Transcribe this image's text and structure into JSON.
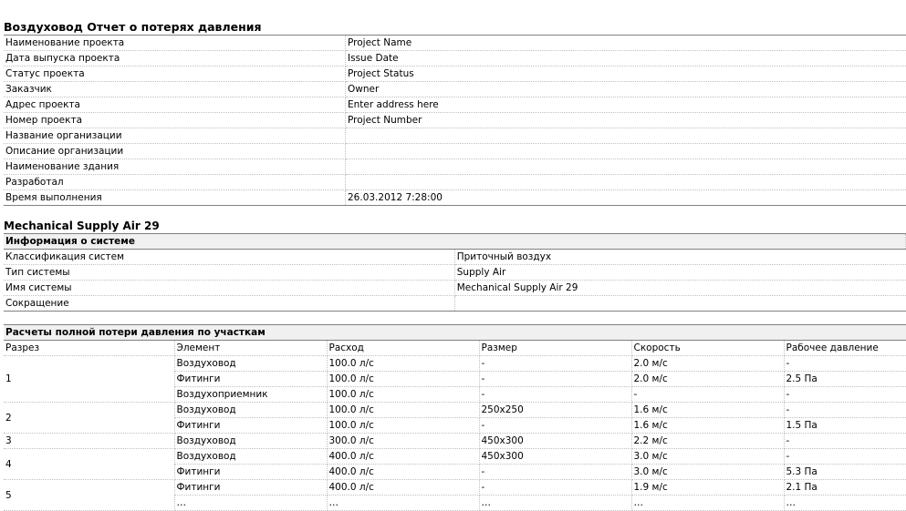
{
  "report_title": "Воздуховод Отчет о потерях давления",
  "project_info": [
    {
      "label": "Наименование проекта",
      "value": "Project Name"
    },
    {
      "label": "Дата выпуска проекта",
      "value": "Issue Date"
    },
    {
      "label": "Статус проекта",
      "value": "Project Status"
    },
    {
      "label": "Заказчик",
      "value": "Owner"
    },
    {
      "label": "Адрес проекта",
      "value": "Enter address here"
    },
    {
      "label": "Номер проекта",
      "value": "Project Number"
    },
    {
      "label": "Название организации",
      "value": ""
    },
    {
      "label": "Описание организации",
      "value": ""
    },
    {
      "label": "Наименование здания",
      "value": ""
    },
    {
      "label": "Разработал",
      "value": ""
    },
    {
      "label": "Время выполнения",
      "value": "26.03.2012 7:28:00"
    }
  ],
  "system_title": "Mechanical Supply Air 29",
  "system_info_header": "Информация о системе",
  "system_info": [
    {
      "label": "Классификация систем",
      "value": "Приточный воздух"
    },
    {
      "label": "Тип системы",
      "value": "Supply Air"
    },
    {
      "label": "Имя системы",
      "value": "Mechanical Supply Air 29"
    },
    {
      "label": "Сокращение",
      "value": ""
    }
  ],
  "calc_header": "Расчеты полной потери давления по участкам",
  "calc_columns": [
    "Разрез",
    "Элемент",
    "Расход",
    "Размер",
    "Скорость",
    "Рабочее давление"
  ],
  "calc_rows": [
    {
      "section": "1",
      "rowspan": 3,
      "element": "Воздуховод",
      "flow": "100.0 л/с",
      "size": "-",
      "velocity": "2.0 м/с",
      "pressure": "-"
    },
    {
      "element": "Фитинги",
      "flow": "100.0 л/с",
      "size": "-",
      "velocity": "2.0 м/с",
      "pressure": "2.5 Па"
    },
    {
      "element": "Воздухоприемник",
      "flow": "100.0 л/с",
      "size": "-",
      "velocity": "-",
      "pressure": "-"
    },
    {
      "section": "2",
      "rowspan": 2,
      "element": "Воздуховод",
      "flow": "100.0 л/с",
      "size": "250x250",
      "velocity": "1.6 м/с",
      "pressure": "-"
    },
    {
      "element": "Фитинги",
      "flow": "100.0 л/с",
      "size": "-",
      "velocity": "1.6 м/с",
      "pressure": "1.5 Па"
    },
    {
      "section": "3",
      "rowspan": 1,
      "element": "Воздуховод",
      "flow": "300.0 л/с",
      "size": "450x300",
      "velocity": "2.2 м/с",
      "pressure": "-"
    },
    {
      "section": "4",
      "rowspan": 2,
      "element": "Воздуховод",
      "flow": "400.0 л/с",
      "size": "450x300",
      "velocity": "3.0 м/с",
      "pressure": "-"
    },
    {
      "element": "Фитинги",
      "flow": "400.0 л/с",
      "size": "-",
      "velocity": "3.0 м/с",
      "pressure": "5.3 Па"
    },
    {
      "section": "5",
      "rowspan": 2,
      "element": "Фитинги",
      "flow": "400.0 л/с",
      "size": "-",
      "velocity": "1.9 м/с",
      "pressure": "2.1 Па"
    },
    {
      "element": "…",
      "flow": "…",
      "size": "…",
      "velocity": "…",
      "pressure": "…"
    }
  ]
}
